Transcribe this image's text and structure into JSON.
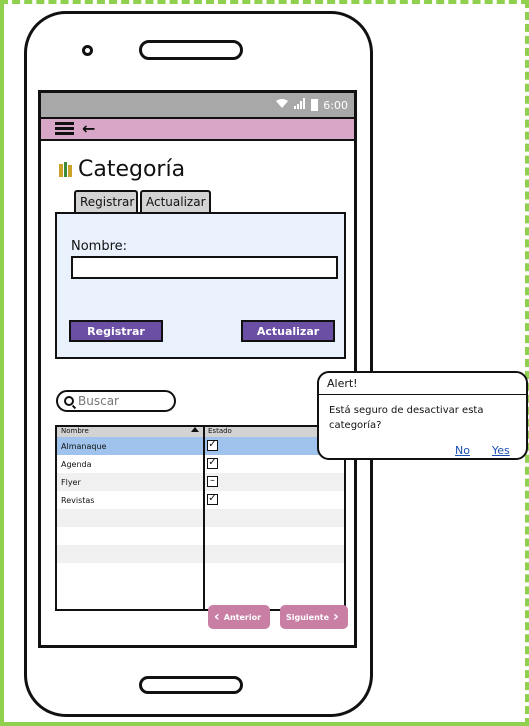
{
  "status_bar": {
    "time": "6:00"
  },
  "screen": {
    "title": "Categoría"
  },
  "tabs": [
    {
      "label": "Registrar"
    },
    {
      "label": "Actualizar"
    }
  ],
  "form": {
    "name_label": "Nombre:",
    "name_value": "",
    "register_label": "Registrar",
    "update_label": "Actualizar"
  },
  "search": {
    "placeholder": "Buscar"
  },
  "table": {
    "columns": [
      "Nombre",
      "Estado"
    ],
    "rows": [
      {
        "name": "Almanaque",
        "state": "checked"
      },
      {
        "name": "Agenda",
        "state": "checked"
      },
      {
        "name": "Flyer",
        "state": "indeterminate"
      },
      {
        "name": "Revistas",
        "state": "checked"
      }
    ]
  },
  "pagination": {
    "prev_label": "Anterior",
    "next_label": "Siguiente"
  },
  "alert": {
    "title": "Alert!",
    "message": "Está seguro de desactivar esta categoría?",
    "no_label": "No",
    "yes_label": "Yes"
  },
  "colors": {
    "appbar": "#d8a7c7",
    "form_panel": "#e8f1fc",
    "button": "#6a4fa4",
    "pager_button": "#c97fa3",
    "selected_row": "#9fc3ec",
    "alt_row": "#f0f0f0",
    "link": "#1a4fb3"
  }
}
